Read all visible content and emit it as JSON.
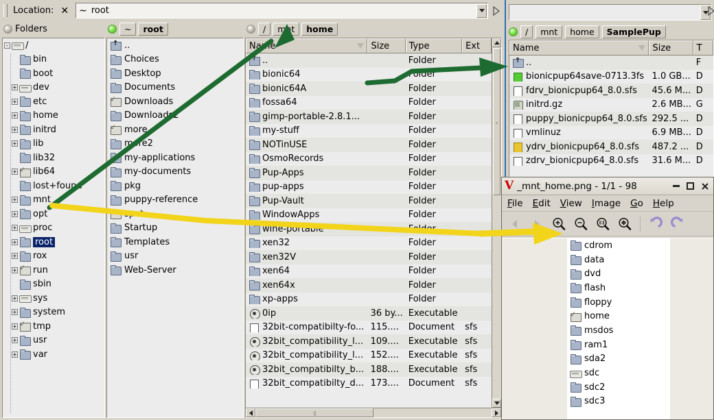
{
  "filer_main": {
    "location_bar": {
      "label": "Location:",
      "close_icon": "close-icon",
      "value": "root",
      "tilde_icon": "tilde-icon",
      "dropdown_icon": "chevron-down-icon",
      "go_icon": "go-arrow-icon"
    },
    "tree_panel": {
      "header_label": "Folders",
      "items": [
        {
          "label": "/",
          "icon": "drive-icon",
          "expander": "-",
          "indent": 0,
          "selected": false
        },
        {
          "label": "bin",
          "icon": "folder-icon",
          "expander": "",
          "indent": 1,
          "selected": false
        },
        {
          "label": "boot",
          "icon": "folder-icon",
          "expander": "",
          "indent": 1,
          "selected": false
        },
        {
          "label": "dev",
          "icon": "drive-icon",
          "expander": "+",
          "indent": 1,
          "selected": false
        },
        {
          "label": "etc",
          "icon": "folder-icon",
          "expander": "+",
          "indent": 1,
          "selected": false
        },
        {
          "label": "home",
          "icon": "folder-icon",
          "expander": "+",
          "indent": 1,
          "selected": false
        },
        {
          "label": "initrd",
          "icon": "folder-icon",
          "expander": "+",
          "indent": 1,
          "selected": false
        },
        {
          "label": "lib",
          "icon": "folder-icon",
          "expander": "+",
          "indent": 1,
          "selected": false
        },
        {
          "label": "lib32",
          "icon": "folder-icon",
          "expander": "",
          "indent": 1,
          "selected": false
        },
        {
          "label": "lib64",
          "icon": "symlink-icon",
          "expander": "+",
          "indent": 1,
          "selected": false
        },
        {
          "label": "lost+found",
          "icon": "folder-icon",
          "expander": "",
          "indent": 1,
          "selected": false
        },
        {
          "label": "mnt",
          "icon": "folder-icon",
          "expander": "+",
          "indent": 1,
          "selected": false
        },
        {
          "label": "opt",
          "icon": "folder-icon",
          "expander": "+",
          "indent": 1,
          "selected": false
        },
        {
          "label": "proc",
          "icon": "drive-icon",
          "expander": "+",
          "indent": 1,
          "selected": false
        },
        {
          "label": "root",
          "icon": "folder-icon",
          "expander": "+",
          "indent": 1,
          "selected": true
        },
        {
          "label": "rox",
          "icon": "folder-icon",
          "expander": "+",
          "indent": 1,
          "selected": false
        },
        {
          "label": "run",
          "icon": "symlink-icon",
          "expander": "+",
          "indent": 1,
          "selected": false
        },
        {
          "label": "sbin",
          "icon": "folder-icon",
          "expander": "",
          "indent": 1,
          "selected": false
        },
        {
          "label": "sys",
          "icon": "drive-icon",
          "expander": "+",
          "indent": 1,
          "selected": false
        },
        {
          "label": "system",
          "icon": "folder-icon",
          "expander": "+",
          "indent": 1,
          "selected": false
        },
        {
          "label": "tmp",
          "icon": "symlink-icon",
          "expander": "+",
          "indent": 1,
          "selected": false
        },
        {
          "label": "usr",
          "icon": "folder-icon",
          "expander": "+",
          "indent": 1,
          "selected": false
        },
        {
          "label": "var",
          "icon": "folder-icon",
          "expander": "+",
          "indent": 1,
          "selected": false
        }
      ]
    },
    "root_panel": {
      "led": "status-led-on",
      "crumbs": [
        {
          "label": "~",
          "active": false
        },
        {
          "label": "root",
          "active": true
        }
      ],
      "items": [
        {
          "label": "..",
          "icon": "parent-folder-icon"
        },
        {
          "label": "Choices",
          "icon": "folder-icon"
        },
        {
          "label": "Desktop",
          "icon": "folder-icon"
        },
        {
          "label": "Documents",
          "icon": "folder-icon"
        },
        {
          "label": "Downloads",
          "icon": "symlink-icon"
        },
        {
          "label": "Downloads2",
          "icon": "folder-icon"
        },
        {
          "label": "more",
          "icon": "symlink-icon"
        },
        {
          "label": "more2",
          "icon": "folder-icon"
        },
        {
          "label": "my-applications",
          "icon": "folder-icon"
        },
        {
          "label": "my-documents",
          "icon": "folder-icon"
        },
        {
          "label": "pkg",
          "icon": "folder-icon"
        },
        {
          "label": "puppy-reference",
          "icon": "folder-icon"
        },
        {
          "label": "spot",
          "icon": "symlink-icon"
        },
        {
          "label": "Startup",
          "icon": "folder-icon"
        },
        {
          "label": "Templates",
          "icon": "folder-icon"
        },
        {
          "label": "usr",
          "icon": "folder-icon"
        },
        {
          "label": "Web-Server",
          "icon": "folder-icon"
        }
      ]
    },
    "home_panel": {
      "led": "status-led-off",
      "crumbs": [
        {
          "label": "/",
          "active": false
        },
        {
          "label": "mnt",
          "active": false
        },
        {
          "label": "home",
          "active": true
        }
      ],
      "columns": [
        "Name",
        "Size",
        "Type",
        "Ext"
      ],
      "sort_icon": "sort-descending-icon",
      "rows": [
        {
          "name": "..",
          "size": "",
          "type": "Folder",
          "ext": "",
          "icon": "parent-folder-icon"
        },
        {
          "name": "bionic64",
          "size": "",
          "type": "Folder",
          "ext": "",
          "icon": "folder-icon"
        },
        {
          "name": "bionic64A",
          "size": "",
          "type": "Folder",
          "ext": "",
          "icon": "folder-icon"
        },
        {
          "name": "fossa64",
          "size": "",
          "type": "Folder",
          "ext": "",
          "icon": "folder-icon"
        },
        {
          "name": "gimp-portable-2.8.1...",
          "size": "",
          "type": "Folder",
          "ext": "",
          "icon": "folder-icon"
        },
        {
          "name": "my-stuff",
          "size": "",
          "type": "Folder",
          "ext": "",
          "icon": "folder-icon"
        },
        {
          "name": "NOTinUSE",
          "size": "",
          "type": "Folder",
          "ext": "",
          "icon": "folder-icon"
        },
        {
          "name": "OsmoRecords",
          "size": "",
          "type": "Folder",
          "ext": "",
          "icon": "folder-icon"
        },
        {
          "name": "Pup-Apps",
          "size": "",
          "type": "Folder",
          "ext": "",
          "icon": "folder-icon"
        },
        {
          "name": "pup-apps",
          "size": "",
          "type": "Folder",
          "ext": "",
          "icon": "folder-icon"
        },
        {
          "name": "Pup-Vault",
          "size": "",
          "type": "Folder",
          "ext": "",
          "icon": "folder-icon"
        },
        {
          "name": "WindowApps",
          "size": "",
          "type": "Folder",
          "ext": "",
          "icon": "folder-icon"
        },
        {
          "name": "wine-portable",
          "size": "",
          "type": "Folder",
          "ext": "",
          "icon": "folder-icon"
        },
        {
          "name": "xen32",
          "size": "",
          "type": "Folder",
          "ext": "",
          "icon": "folder-icon"
        },
        {
          "name": "xen32V",
          "size": "",
          "type": "Folder",
          "ext": "",
          "icon": "folder-icon"
        },
        {
          "name": "xen64",
          "size": "",
          "type": "Folder",
          "ext": "",
          "icon": "folder-icon"
        },
        {
          "name": "xen64x",
          "size": "",
          "type": "Folder",
          "ext": "",
          "icon": "folder-icon"
        },
        {
          "name": "xp-apps",
          "size": "",
          "type": "Folder",
          "ext": "",
          "icon": "folder-icon"
        },
        {
          "name": "0ip",
          "size": "36 by...",
          "type": "Executable",
          "ext": "",
          "icon": "executable-icon"
        },
        {
          "name": "32bit-compatibilty-fo...",
          "size": "115....",
          "type": "Document",
          "ext": "sfs",
          "icon": "document-icon"
        },
        {
          "name": "32bit_compatibility_l...",
          "size": "109....",
          "type": "Executable",
          "ext": "sfs",
          "icon": "executable-icon"
        },
        {
          "name": "32bit_compatibility_l...",
          "size": "152....",
          "type": "Executable",
          "ext": "sfs",
          "icon": "executable-icon"
        },
        {
          "name": "32bit_compatibilty_b...",
          "size": "188....",
          "type": "Executable",
          "ext": "sfs",
          "icon": "executable-icon"
        },
        {
          "name": "32bit_compatibilty_d...",
          "size": "173....",
          "type": "Document",
          "ext": "sfs",
          "icon": "document-icon"
        }
      ]
    }
  },
  "filer_right": {
    "location_bar": {
      "value": "",
      "dropdown_icon": "chevron-down-icon",
      "go_icon": "go-arrow-icon"
    },
    "led": "status-led-on",
    "crumbs": [
      {
        "label": "/",
        "active": false
      },
      {
        "label": "mnt",
        "active": false
      },
      {
        "label": "home",
        "active": false
      },
      {
        "label": "SamplePup",
        "active": true
      }
    ],
    "columns": [
      "Name",
      "Size",
      "T"
    ],
    "sort_icon": "sort-descending-icon",
    "rows": [
      {
        "name": "..",
        "size": "",
        "type": "F",
        "icon": "parent-folder-icon"
      },
      {
        "name": "bionicpup64save-0713.3fs",
        "size": "1.0 GB...",
        "type": "D",
        "icon": "green-file-icon"
      },
      {
        "name": "fdrv_bionicpup64_8.0.sfs",
        "size": "45.6 M...",
        "type": "D",
        "icon": "document-icon"
      },
      {
        "name": "initrd.gz",
        "size": "2.6 MB...",
        "type": "G",
        "icon": "archive-icon"
      },
      {
        "name": "puppy_bionicpup64_8.0.sfs",
        "size": "292.5 ...",
        "type": "D",
        "icon": "document-icon"
      },
      {
        "name": "vmlinuz",
        "size": "6.9 MB...",
        "type": "D",
        "icon": "document-icon"
      },
      {
        "name": "ydrv_bionicpup64_8.0.sfs",
        "size": "487.2 ...",
        "type": "D",
        "icon": "yellow-file-icon"
      },
      {
        "name": "zdrv_bionicpup64_8.0.sfs",
        "size": "31.6 M...",
        "type": "D",
        "icon": "document-icon"
      }
    ]
  },
  "viewer": {
    "title": "_mnt_home.png - 1/1 - 98",
    "logo_icon": "viewnior-logo-icon",
    "window_controls": [
      {
        "name": "minimize-button",
        "glyph": "—"
      },
      {
        "name": "maximize-button",
        "glyph": "□"
      },
      {
        "name": "close-button",
        "glyph": "✕"
      }
    ],
    "menu": [
      "File",
      "Edit",
      "View",
      "Image",
      "Go",
      "Help"
    ],
    "toolbar": [
      {
        "name": "previous-image-button",
        "icon": "triangle-left-icon",
        "disabled": true
      },
      {
        "name": "next-image-button",
        "icon": "triangle-right-icon",
        "disabled": true
      },
      {
        "name": "zoom-in-button",
        "icon": "zoom-in-icon",
        "disabled": false
      },
      {
        "name": "zoom-out-button",
        "icon": "zoom-out-icon",
        "disabled": false
      },
      {
        "name": "zoom-normal-button",
        "icon": "zoom-100-icon",
        "disabled": false
      },
      {
        "name": "zoom-fit-button",
        "icon": "zoom-fit-icon",
        "disabled": false
      },
      {
        "name": "rotate-left-button",
        "icon": "rotate-left-icon",
        "disabled": false
      },
      {
        "name": "rotate-right-button",
        "icon": "rotate-right-icon",
        "disabled": false
      }
    ],
    "image_content": {
      "rows": [
        {
          "label": "cdrom",
          "icon": "folder-icon"
        },
        {
          "label": "data",
          "icon": "folder-icon"
        },
        {
          "label": "dvd",
          "icon": "folder-icon"
        },
        {
          "label": "flash",
          "icon": "folder-icon"
        },
        {
          "label": "floppy",
          "icon": "folder-icon"
        },
        {
          "label": "home",
          "icon": "symlink-icon"
        },
        {
          "label": "msdos",
          "icon": "folder-icon"
        },
        {
          "label": "ram1",
          "icon": "folder-icon"
        },
        {
          "label": "sda2",
          "icon": "folder-icon"
        },
        {
          "label": "sdc",
          "icon": "drive-icon"
        },
        {
          "label": "sdc2",
          "icon": "folder-icon"
        },
        {
          "label": "sdc3",
          "icon": "folder-icon"
        }
      ]
    }
  },
  "annotations": {
    "green_arrow_color": "#1e6b32",
    "yellow_arrow_color": "#f2d41a",
    "green_arrow_note": "from mnt in tree, up to mnt crumb and across to parent folder of SamplePup",
    "yellow_arrow_note": "from mnt in tree across to the zoom-in button of the viewer"
  }
}
